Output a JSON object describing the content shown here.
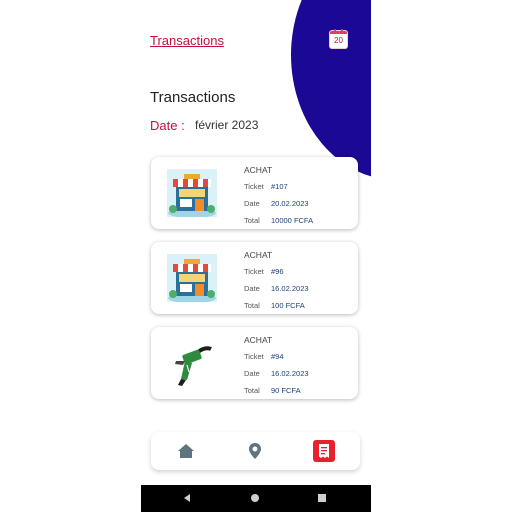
{
  "header": {
    "link_label": "Transactions",
    "calendar_day": "20"
  },
  "page": {
    "heading": "Transactions",
    "date_label": "Date :",
    "date_value": "février 2023"
  },
  "labels": {
    "ticket": "Ticket",
    "date": "Date",
    "total": "Total"
  },
  "transactions": [
    {
      "type": "ACHAT",
      "ticket": "#107",
      "date": "20.02.2023",
      "total": "10000 FCFA",
      "icon": "store-icon"
    },
    {
      "type": "ACHAT",
      "ticket": "#96",
      "date": "16.02.2023",
      "total": "100 FCFA",
      "icon": "store-icon"
    },
    {
      "type": "ACHAT",
      "ticket": "#94",
      "date": "16.02.2023",
      "total": "90 FCFA",
      "icon": "fuel-nozzle-icon"
    }
  ],
  "bottom_nav": [
    "home-icon",
    "location-pin-icon",
    "receipt-icon"
  ],
  "colors": {
    "accent": "#c4103c",
    "blob": "#1b0996",
    "nav_icon": "#5f7481",
    "active": "#e8202e"
  }
}
